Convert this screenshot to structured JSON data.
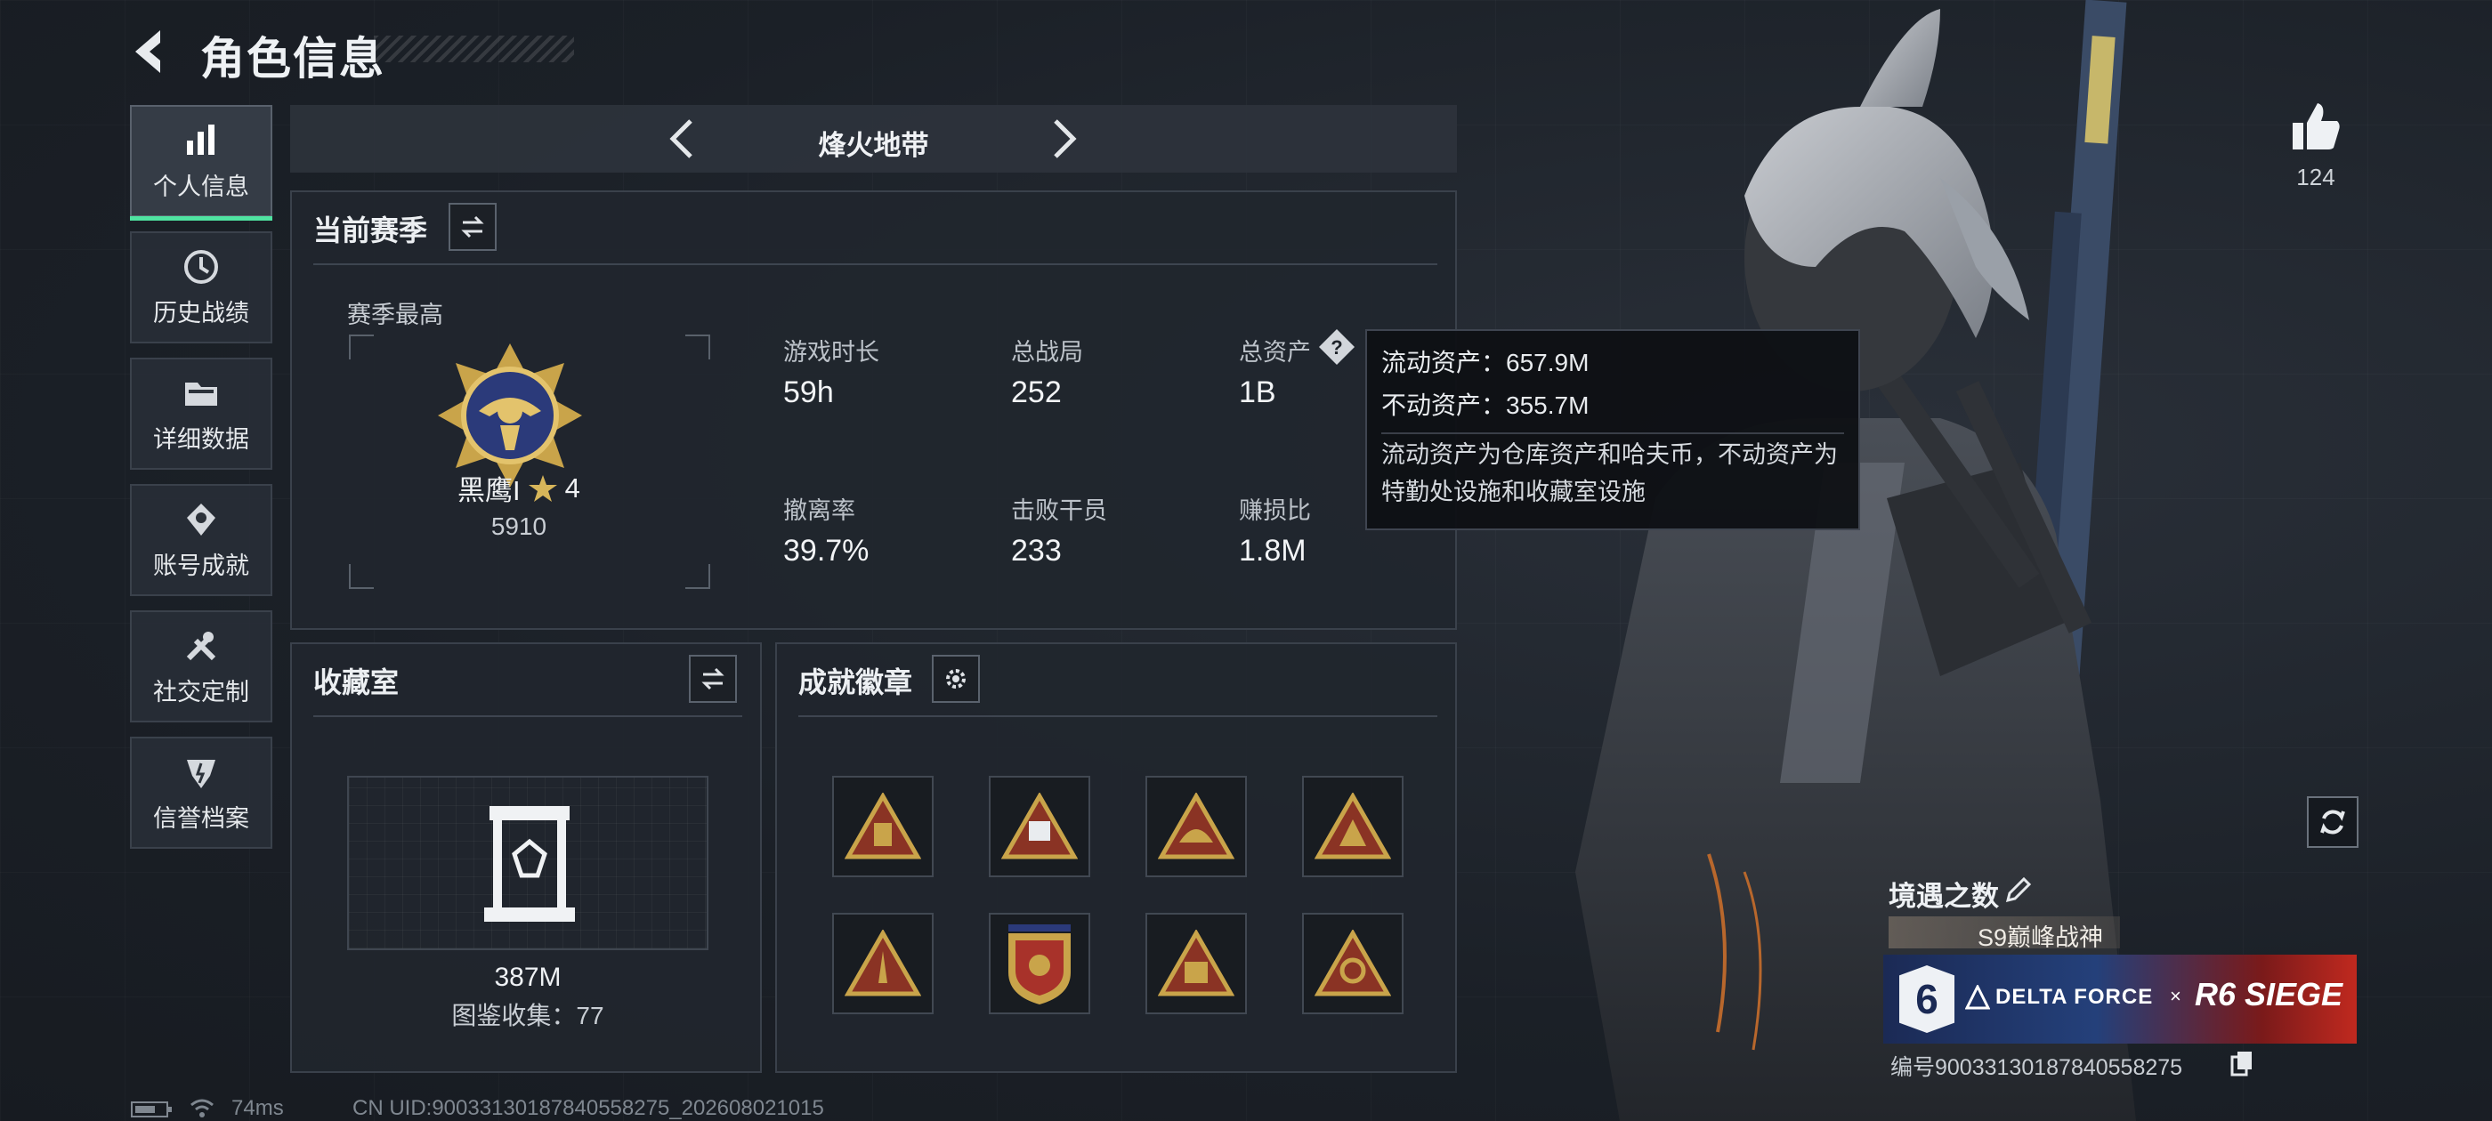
{
  "header": {
    "title": "角色信息"
  },
  "sidebar": {
    "items": [
      {
        "label": "个人信息",
        "icon": "bar-chart-icon",
        "active": true
      },
      {
        "label": "历史战绩",
        "icon": "history-icon",
        "active": false
      },
      {
        "label": "详细数据",
        "icon": "folder-icon",
        "active": false
      },
      {
        "label": "账号成就",
        "icon": "achievement-icon",
        "active": false
      },
      {
        "label": "社交定制",
        "icon": "tools-icon",
        "active": false
      },
      {
        "label": "信誉档案",
        "icon": "shield-icon",
        "active": false
      }
    ]
  },
  "mode": {
    "title": "烽火地带"
  },
  "season": {
    "title": "当前赛季",
    "highest_label": "赛季最高",
    "rank_name": "黑鹰I",
    "rank_stars": "4",
    "rank_score": "5910",
    "stats": [
      {
        "label": "游戏时长",
        "value": "59h"
      },
      {
        "label": "总战局",
        "value": "252"
      },
      {
        "label": "总资产",
        "value": "1B"
      },
      {
        "label": "撤离率",
        "value": "39.7%"
      },
      {
        "label": "击败干员",
        "value": "233"
      },
      {
        "label": "赚损比",
        "value": "1.8M"
      }
    ]
  },
  "tooltip": {
    "liquid": "流动资产：657.9M",
    "fixed": "不动资产：355.7M",
    "description": "流动资产为仓库资产和哈夫币，不动资产为特勤处设施和收藏室设施"
  },
  "collection": {
    "title": "收藏室",
    "value": "387M",
    "catalog": "图鉴收集：77"
  },
  "badges": {
    "title": "成就徽章",
    "items": [
      "badge-1",
      "badge-2",
      "badge-3",
      "badge-4",
      "badge-5",
      "badge-6",
      "badge-7",
      "badge-8"
    ]
  },
  "profile": {
    "likes": "124"
  },
  "encounter": {
    "title": "境遇之数",
    "tag": "S9巅峰战神",
    "banner_number": "6",
    "banner_left": "DELTA FORCE",
    "banner_x": "×",
    "banner_right": "R6 SIEGE",
    "serial": "编号9003313018784055827​5"
  },
  "footer": {
    "ping": "74ms",
    "uid": "CN UID:9003313018784055827​5_202608021015"
  },
  "colors": {
    "accent": "#4fe3a1",
    "gold": "#c9a44a",
    "panel": "#21262e"
  }
}
